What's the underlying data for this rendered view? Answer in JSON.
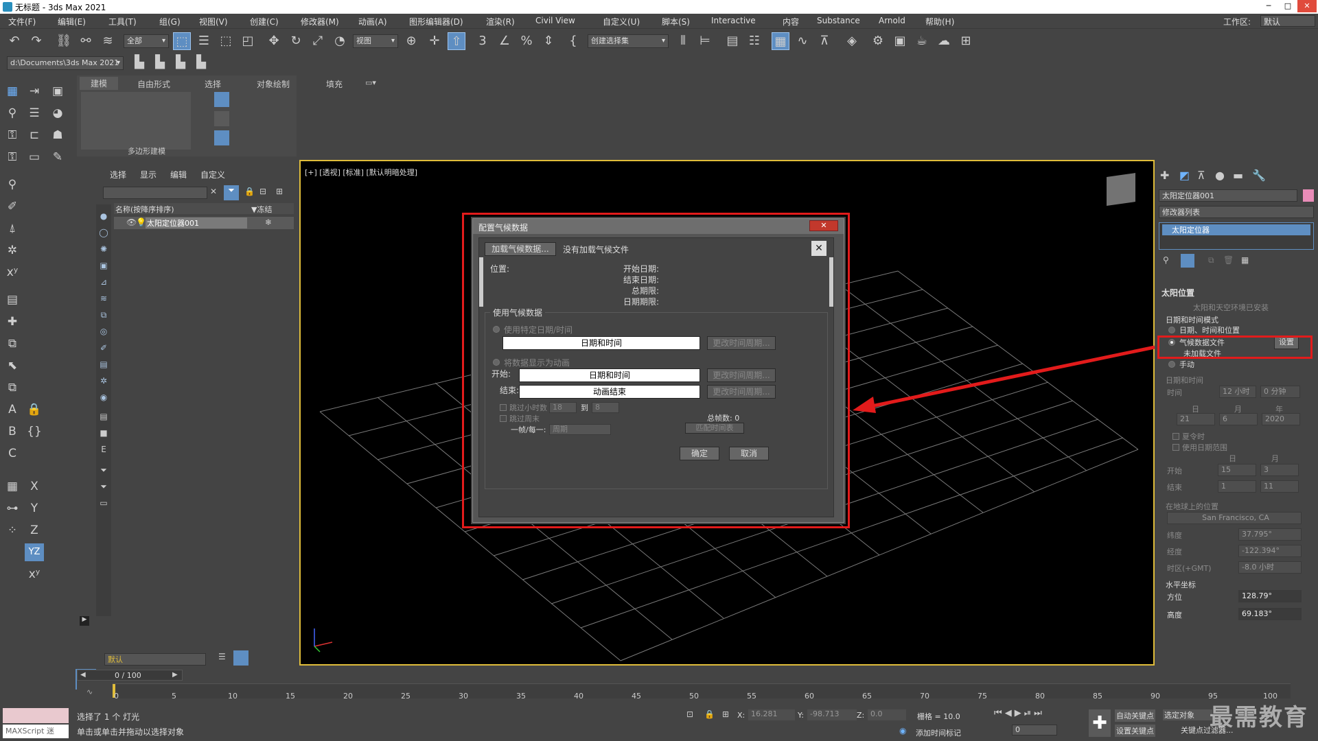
{
  "title_bar": {
    "title": "无标题 - 3ds Max 2021",
    "minimize": "─",
    "maximize": "□",
    "close": "✕"
  },
  "menu": [
    "文件(F)",
    "编辑(E)",
    "工具(T)",
    "组(G)",
    "视图(V)",
    "创建(C)",
    "修改器(M)",
    "动画(A)",
    "图形编辑器(D)",
    "渲染(R)",
    "Civil View",
    "自定义(U)",
    "脚本(S)",
    "Interactive",
    "内容",
    "Substance",
    "Arnold",
    "帮助(H)"
  ],
  "workspace": {
    "label": "工作区:",
    "value": "默认"
  },
  "toolbar": {
    "selection_filter": "全部",
    "ref_coord": "视图",
    "named_selection": "创建选择集",
    "path": "d:\\Documents\\3ds Max 2021"
  },
  "ribbon": {
    "tabs": [
      "建模",
      "自由形式",
      "选择",
      "对象绘制",
      "填充"
    ],
    "group_label": "多边形建模"
  },
  "scene_explorer": {
    "tabs": [
      "选择",
      "显示",
      "编辑",
      "自定义"
    ],
    "col_name": "名称(按降序排序)",
    "col_freeze": "▼冻结",
    "rows": [
      {
        "name": "太阳定位器001"
      }
    ],
    "layer": "默认",
    "frame_counter": "0 / 100"
  },
  "viewport": {
    "label": "[+] [透视] [标准] [默认明暗处理]"
  },
  "dialog": {
    "title": "配置气候数据",
    "close": "✕",
    "load_button": "加载气候数据...",
    "no_file": "没有加载气候文件",
    "location_label": "位置:",
    "start_date": "开始日期:",
    "end_date": "结束日期:",
    "total_period": "总期限:",
    "date_period": "日期期限:",
    "group_label": "使用气候数据",
    "use_specific": "使用特定日期/时间",
    "datetime_field": "日期和时间",
    "change_period": "更改时间周期...",
    "animate_label": "将数据显示为动画",
    "start_label": "开始:",
    "start_field": "日期和时间",
    "end_label": "结束:",
    "end_field": "动画结束",
    "skip_hours": "跳过小时数",
    "skip_from": "18",
    "to_label": "到",
    "skip_to": "8",
    "skip_weekends": "跳过周末",
    "per_frame": "一帧/每一:",
    "per_frame_value": "周期",
    "total_frames": "总帧数: 0",
    "match_timeline": "匹配时间表",
    "ok": "确定",
    "cancel": "取消"
  },
  "command_panel": {
    "object_name": "太阳定位器001",
    "modifier_list": "修改器列表",
    "stack_item": "太阳定位器",
    "rollout_title": "太阳位置",
    "installed_note": "太阳和天空环境已安装",
    "date_mode_label": "日期和时间模式",
    "mode_datetime_location": "日期、时间和位置",
    "mode_weather_file": "气候数据文件",
    "setup_button": "设置",
    "not_loaded": "未加载文件",
    "mode_manual": "手动",
    "date_time_label": "日期和时间",
    "time_label": "时间",
    "hour": "12 小时",
    "minute": "0 分钟",
    "day_label": "日",
    "month_label": "月",
    "year_label": "年",
    "day": "21",
    "month": "6",
    "year": "2020",
    "dst": "夏令时",
    "use_range": "使用日期范围",
    "range_day": "日",
    "range_month": "月",
    "range_start": "开始",
    "range_end": "结束",
    "start_day": "15",
    "start_month": "3",
    "end_day": "1",
    "end_month": "11",
    "earth_loc_label": "在地球上的位置",
    "city": "San Francisco, CA",
    "lat_label": "纬度",
    "lat": "37.795°",
    "lon_label": "经度",
    "lon": "-122.394°",
    "tz_label": "时区(+GMT)",
    "tz": "-8.0 小时",
    "horiz_label": "水平坐标",
    "azimuth_label": "方位",
    "azimuth": "128.79°",
    "altitude_label": "高度",
    "altitude": "69.183°"
  },
  "timeline": {
    "ticks": [
      "0",
      "5",
      "10",
      "15",
      "20",
      "25",
      "30",
      "35",
      "40",
      "45",
      "50",
      "55",
      "60",
      "65",
      "70",
      "75",
      "80",
      "85",
      "90",
      "95",
      "100"
    ]
  },
  "status": {
    "selected": "选择了 1 个 灯光",
    "hint": "单击或单击并拖动以选择对象",
    "maxscript": "MAXScript 迷",
    "x_label": "X:",
    "x": "16.281",
    "y_label": "Y:",
    "y": "-98.713",
    "z_label": "Z:",
    "z": "0.0",
    "grid": "栅格 = 10.0",
    "add_time_tag": "添加时间标记",
    "auto_key": "自动关键点",
    "set_key": "设置关键点",
    "selected_object": "选定对象",
    "key_filters": "关键点过滤器...",
    "frame": "0"
  },
  "watermark": "最需教育",
  "colors": {
    "accent_red": "#e21b1b",
    "viewport_border": "#e0bd3a",
    "selection_blue": "#5e8ec2"
  }
}
